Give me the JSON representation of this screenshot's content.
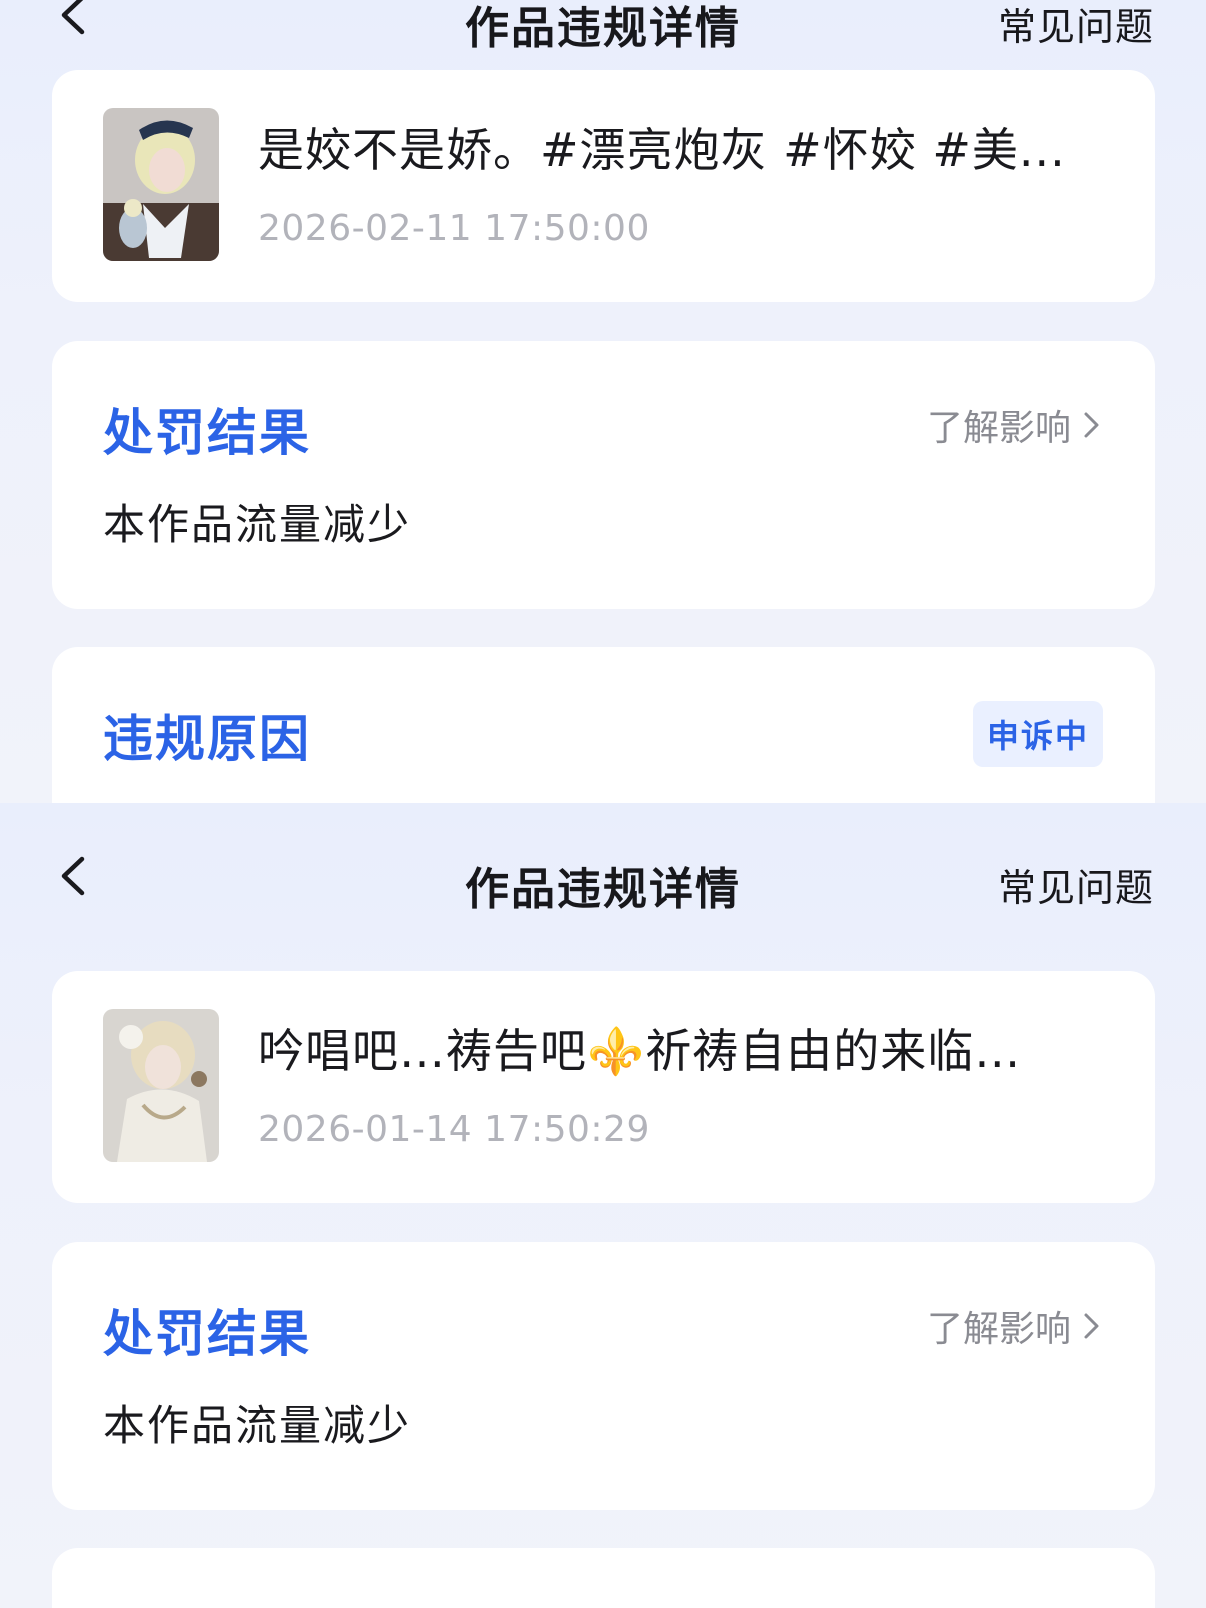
{
  "colors": {
    "accent": "#2b63e6",
    "background": "#eef1fb",
    "card": "#ffffff",
    "muted": "#b2b3ba",
    "secondary": "#8a8b92"
  },
  "top": {
    "nav": {
      "title": "作品违规详情",
      "faq": "常见问题"
    },
    "work": {
      "title": "是姣不是娇。#漂亮炮灰 #怀姣 #美...",
      "date": "2026-02-11 17:50:00"
    },
    "penalty": {
      "title": "处罚结果",
      "learn_more": "了解影响",
      "text": "本作品流量减少"
    },
    "violation": {
      "title": "违规原因",
      "status": "申诉中"
    }
  },
  "bottom": {
    "nav": {
      "title": "作品违规详情",
      "faq": "常见问题"
    },
    "work": {
      "title": "吟唱吧…祷告吧⚜️祈祷自由的来临…",
      "date": "2026-01-14 17:50:29"
    },
    "penalty": {
      "title": "处罚结果",
      "learn_more": "了解影响",
      "text": "本作品流量减少"
    }
  }
}
